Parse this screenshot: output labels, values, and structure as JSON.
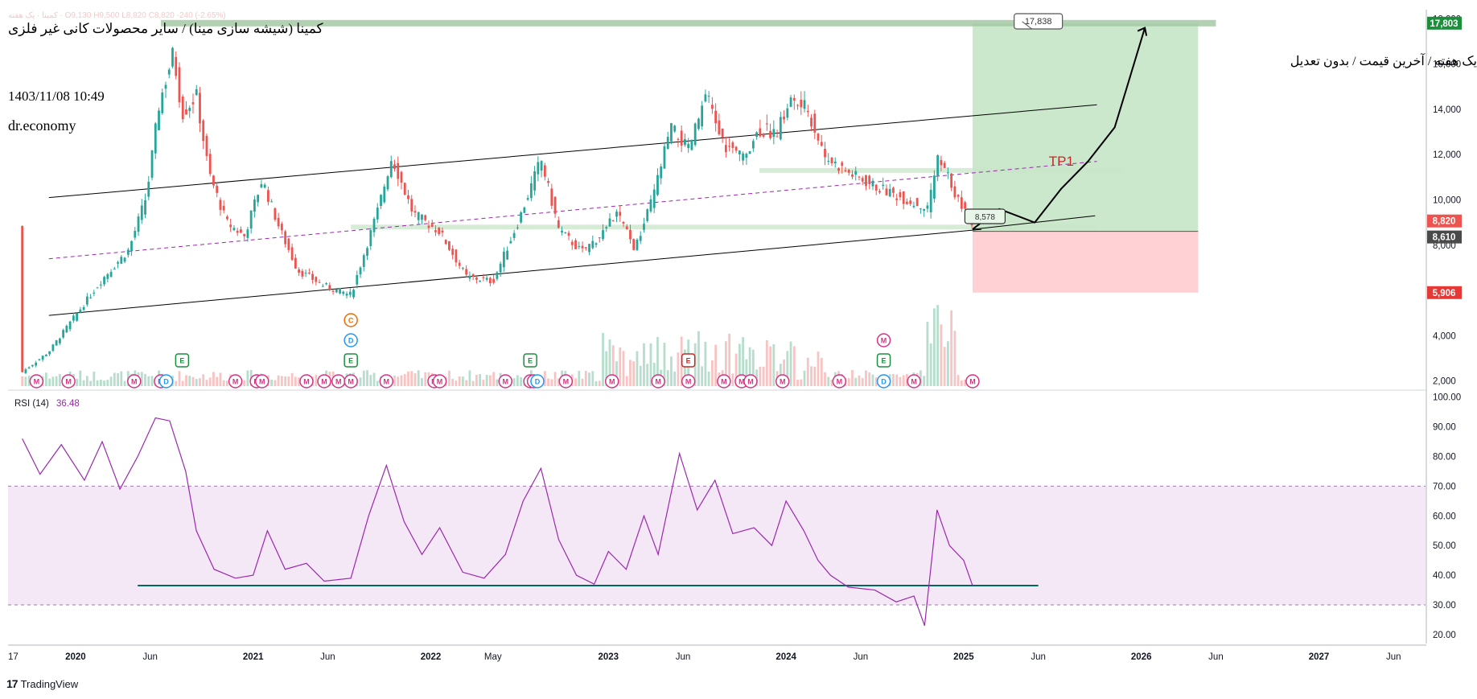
{
  "header": {
    "ohlc_text": "کمینا · یک هفته ·  O9,130  H9,500  L8,820  C8,820  -240 (-2.65%)",
    "title": "کمینا (شیشه سازی مینا) / سایر محصولات کانی غیر فلزی",
    "subtitle": "یک هفته / آخرین قیمت / بدون تعدیل",
    "timestamp": "1403/11/08 10:49",
    "author": "dr.economy"
  },
  "watermark": "TradingView",
  "colors": {
    "up": "#26a69a",
    "down": "#ef5350",
    "channel": "#000000",
    "midline": "#9c27b0",
    "target_zone": "#c8e6c9",
    "stop_zone": "#ffcdd2",
    "rsi_line": "#9c27b0",
    "rsi_band": "#f3e5f5",
    "rsi_support": "#00695c"
  },
  "chart_data": [
    {
      "type": "line",
      "title": "",
      "description_series": "weekly price (close, approximate)",
      "x_ticks": [
        "17",
        "2020",
        "Jun",
        "2021",
        "Jun",
        "2022",
        "May",
        "2023",
        "Jun",
        "2024",
        "Jun",
        "2025",
        "Jun",
        "2026",
        "Jun",
        "2027",
        "Jun"
      ],
      "y_ticks": [
        "2,000",
        "4,000",
        "6,000",
        "8,000",
        "10,000",
        "12,000",
        "14,000",
        "16,000",
        "18,000"
      ],
      "ylim": [
        1600,
        18400
      ],
      "price_points": [
        {
          "t": 2019.7,
          "v": 2400
        },
        {
          "t": 2019.85,
          "v": 3300
        },
        {
          "t": 2020.0,
          "v": 4900
        },
        {
          "t": 2020.15,
          "v": 6500
        },
        {
          "t": 2020.3,
          "v": 7800
        },
        {
          "t": 2020.4,
          "v": 10200
        },
        {
          "t": 2020.47,
          "v": 14200
        },
        {
          "t": 2020.55,
          "v": 16500
        },
        {
          "t": 2020.6,
          "v": 13800
        },
        {
          "t": 2020.68,
          "v": 14600
        },
        {
          "t": 2020.75,
          "v": 11200
        },
        {
          "t": 2020.85,
          "v": 9000
        },
        {
          "t": 2020.95,
          "v": 8400
        },
        {
          "t": 2021.05,
          "v": 10900
        },
        {
          "t": 2021.15,
          "v": 8700
        },
        {
          "t": 2021.25,
          "v": 6900
        },
        {
          "t": 2021.4,
          "v": 6200
        },
        {
          "t": 2021.55,
          "v": 5800
        },
        {
          "t": 2021.7,
          "v": 9500
        },
        {
          "t": 2021.78,
          "v": 11900
        },
        {
          "t": 2021.9,
          "v": 9400
        },
        {
          "t": 2022.05,
          "v": 8600
        },
        {
          "t": 2022.2,
          "v": 6600
        },
        {
          "t": 2022.35,
          "v": 6400
        },
        {
          "t": 2022.5,
          "v": 9200
        },
        {
          "t": 2022.62,
          "v": 11800
        },
        {
          "t": 2022.72,
          "v": 8700
        },
        {
          "t": 2022.85,
          "v": 7700
        },
        {
          "t": 2022.95,
          "v": 8400
        },
        {
          "t": 2023.05,
          "v": 9400
        },
        {
          "t": 2023.15,
          "v": 7800
        },
        {
          "t": 2023.25,
          "v": 10100
        },
        {
          "t": 2023.35,
          "v": 13200
        },
        {
          "t": 2023.45,
          "v": 12200
        },
        {
          "t": 2023.55,
          "v": 14600
        },
        {
          "t": 2023.65,
          "v": 12400
        },
        {
          "t": 2023.75,
          "v": 11900
        },
        {
          "t": 2023.85,
          "v": 13100
        },
        {
          "t": 2023.95,
          "v": 13000
        },
        {
          "t": 2024.02,
          "v": 14400
        },
        {
          "t": 2024.12,
          "v": 14000
        },
        {
          "t": 2024.22,
          "v": 11900
        },
        {
          "t": 2024.35,
          "v": 11200
        },
        {
          "t": 2024.5,
          "v": 10600
        },
        {
          "t": 2024.65,
          "v": 10100
        },
        {
          "t": 2024.8,
          "v": 9600
        },
        {
          "t": 2024.85,
          "v": 11800
        },
        {
          "t": 2024.92,
          "v": 10900
        },
        {
          "t": 2024.98,
          "v": 9800
        },
        {
          "t": 2025.05,
          "v": 8820
        }
      ],
      "volume_markers": {
        "M": 28,
        "E": 6,
        "D": 6,
        "C": 1
      },
      "price_labels": [
        {
          "text": "17,803",
          "color": "#1b8f3a"
        },
        {
          "text": "8,820",
          "color": "#ef5350"
        },
        {
          "text": "8,610",
          "color": "#4a4a4a"
        },
        {
          "text": "5,906",
          "color": "#e53935"
        }
      ],
      "annotations": {
        "target_callout": "17,838",
        "entry_callout": "8,578",
        "tp_label": "TP1"
      },
      "channel": {
        "upper": [
          [
            2019.85,
            10100
          ],
          [
            2025.75,
            14200
          ]
        ],
        "lower": [
          [
            2019.85,
            4900
          ],
          [
            2025.1,
            8700
          ]
        ],
        "mid_dashed": [
          [
            2019.85,
            7400
          ],
          [
            2025.75,
            11700
          ]
        ]
      },
      "projection_path": [
        [
          2025.05,
          8700
        ],
        [
          2025.2,
          9600
        ],
        [
          2025.4,
          9000
        ],
        [
          2025.55,
          10500
        ],
        [
          2025.7,
          11700
        ],
        [
          2025.85,
          13200
        ],
        [
          2025.92,
          15000
        ],
        [
          2026.02,
          17600
        ]
      ],
      "target_zone": {
        "x0": 2025.05,
        "x1": 2026.32,
        "top": 17803,
        "entry": 8610,
        "stop": 5906
      }
    },
    {
      "type": "line",
      "title": "RSI (14)",
      "legend_value": "36.48",
      "y_ticks": [
        "100.00",
        "90.00",
        "80.00",
        "70.00",
        "60.00",
        "50.00",
        "40.00",
        "30.00",
        "20.00"
      ],
      "ylim": [
        17,
        101
      ],
      "band": [
        30,
        70
      ],
      "support_level": 36.5,
      "points": [
        {
          "t": 2019.7,
          "v": 86
        },
        {
          "t": 2019.8,
          "v": 74
        },
        {
          "t": 2019.92,
          "v": 84
        },
        {
          "t": 2020.05,
          "v": 72
        },
        {
          "t": 2020.15,
          "v": 85
        },
        {
          "t": 2020.25,
          "v": 69
        },
        {
          "t": 2020.35,
          "v": 80
        },
        {
          "t": 2020.45,
          "v": 93
        },
        {
          "t": 2020.53,
          "v": 92
        },
        {
          "t": 2020.62,
          "v": 75
        },
        {
          "t": 2020.68,
          "v": 55
        },
        {
          "t": 2020.78,
          "v": 42
        },
        {
          "t": 2020.9,
          "v": 39
        },
        {
          "t": 2021.0,
          "v": 40
        },
        {
          "t": 2021.08,
          "v": 55
        },
        {
          "t": 2021.18,
          "v": 42
        },
        {
          "t": 2021.3,
          "v": 44
        },
        {
          "t": 2021.4,
          "v": 38
        },
        {
          "t": 2021.55,
          "v": 39
        },
        {
          "t": 2021.65,
          "v": 60
        },
        {
          "t": 2021.75,
          "v": 77
        },
        {
          "t": 2021.85,
          "v": 58
        },
        {
          "t": 2021.95,
          "v": 47
        },
        {
          "t": 2022.05,
          "v": 56
        },
        {
          "t": 2022.18,
          "v": 41
        },
        {
          "t": 2022.3,
          "v": 39
        },
        {
          "t": 2022.42,
          "v": 47
        },
        {
          "t": 2022.52,
          "v": 65
        },
        {
          "t": 2022.62,
          "v": 76
        },
        {
          "t": 2022.72,
          "v": 52
        },
        {
          "t": 2022.82,
          "v": 40
        },
        {
          "t": 2022.92,
          "v": 37
        },
        {
          "t": 2023.0,
          "v": 48
        },
        {
          "t": 2023.1,
          "v": 42
        },
        {
          "t": 2023.2,
          "v": 60
        },
        {
          "t": 2023.28,
          "v": 47
        },
        {
          "t": 2023.4,
          "v": 81
        },
        {
          "t": 2023.5,
          "v": 62
        },
        {
          "t": 2023.6,
          "v": 72
        },
        {
          "t": 2023.7,
          "v": 54
        },
        {
          "t": 2023.82,
          "v": 56
        },
        {
          "t": 2023.92,
          "v": 50
        },
        {
          "t": 2024.0,
          "v": 65
        },
        {
          "t": 2024.1,
          "v": 55
        },
        {
          "t": 2024.18,
          "v": 45
        },
        {
          "t": 2024.25,
          "v": 40
        },
        {
          "t": 2024.35,
          "v": 36
        },
        {
          "t": 2024.5,
          "v": 35
        },
        {
          "t": 2024.62,
          "v": 31
        },
        {
          "t": 2024.72,
          "v": 33
        },
        {
          "t": 2024.78,
          "v": 23
        },
        {
          "t": 2024.85,
          "v": 62
        },
        {
          "t": 2024.92,
          "v": 50
        },
        {
          "t": 2025.0,
          "v": 45
        },
        {
          "t": 2025.05,
          "v": 36.48
        }
      ]
    }
  ]
}
